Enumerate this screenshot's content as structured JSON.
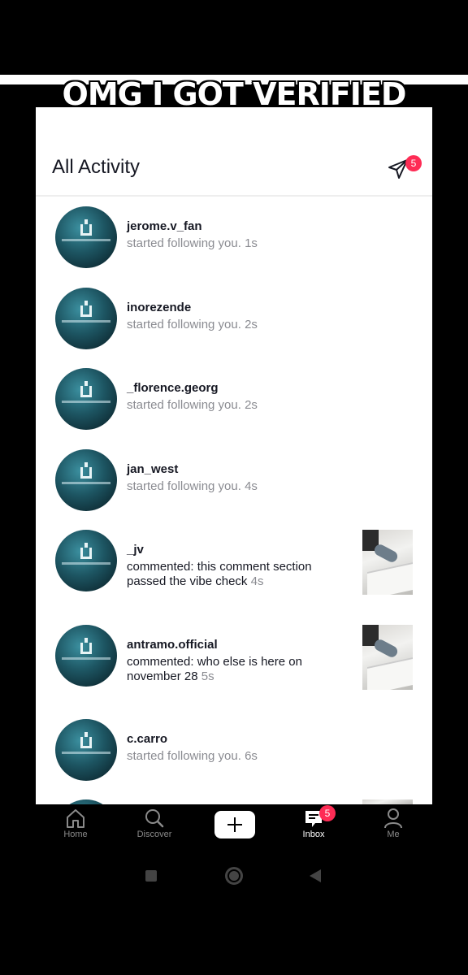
{
  "caption": "OMG I GOT VERIFIED",
  "header": {
    "title": "All Activity",
    "dm_badge": "5"
  },
  "activity": [
    {
      "username": "jerome.v_fan",
      "text": "started following you. 1s"
    },
    {
      "username": "inorezende",
      "text": "started following you. 2s"
    },
    {
      "username": "_florence.georg",
      "text": "started following you. 2s"
    },
    {
      "username": "jan_west",
      "text": "started following you. 4s"
    },
    {
      "username": "_jv",
      "comment": "commented: this comment section passed the vibe check",
      "time": "4s"
    },
    {
      "username": "antramo.official",
      "comment": "commented: who else is here on november 28",
      "time": "5s"
    },
    {
      "username": "c.carro",
      "text": "started following you. 6s"
    }
  ],
  "tabbar": {
    "home": "Home",
    "discover": "Discover",
    "inbox": "Inbox",
    "inbox_badge": "5",
    "me": "Me"
  },
  "colors": {
    "badge": "#fe2c55",
    "muted_text": "#8a8b91",
    "primary_text": "#161823"
  }
}
